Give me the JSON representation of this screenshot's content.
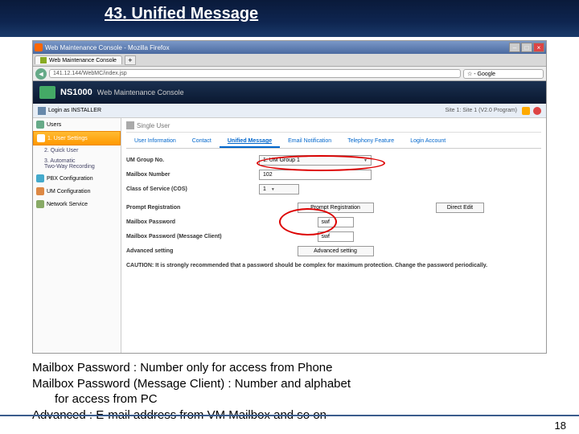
{
  "slide": {
    "title": "43. Unified Message",
    "page_number": "18"
  },
  "firefox": {
    "window_title": "Web Maintenance Console - Mozilla Firefox",
    "tab_title": "Web Maintenance Console",
    "address": "141.12.144/WebMC/index.jsp",
    "search_placeholder": "Google"
  },
  "wmc": {
    "product": "NS1000",
    "title": "Web Maintenance Console",
    "login_user": "Login as INSTALLER",
    "site_info": "Site 1: Site 1 (V2.0 Program)"
  },
  "sidebar": {
    "items": [
      {
        "label": "Users"
      },
      {
        "label": "1. User Settings",
        "selected": true
      },
      {
        "label": "2. Quick User",
        "sub": true
      },
      {
        "label": "3. Automatic\nTwo-Way Recording",
        "sub": true
      },
      {
        "label": "PBX Configuration"
      },
      {
        "label": "UM Configuration"
      },
      {
        "label": "Network Service"
      }
    ]
  },
  "breadcrumb": "Single User",
  "tabs": [
    {
      "label": "User Information"
    },
    {
      "label": "Contact"
    },
    {
      "label": "Unified Message",
      "active": true
    },
    {
      "label": "Email Notification"
    },
    {
      "label": "Telephony Feature"
    },
    {
      "label": "Login Account"
    }
  ],
  "form": {
    "um_group": {
      "label": "UM Group No.",
      "value": "1: UM Group 1"
    },
    "mailbox_no": {
      "label": "Mailbox Number",
      "value": "102"
    },
    "cos": {
      "label": "Class of Service (COS)",
      "value": "1"
    },
    "prompt": {
      "label": "Prompt Registration",
      "btn1": "Prompt Registration",
      "btn2": "Direct Edit"
    },
    "pwd1": {
      "label": "Mailbox Password",
      "value": "swf"
    },
    "pwd2": {
      "label": "Mailbox Password (Message Client)",
      "value": "swf"
    },
    "advanced": {
      "label": "Advanced setting",
      "btn": "Advanced setting"
    },
    "caution": "CAUTION: It is strongly recommended that a password should be complex for maximum protection. Change the password periodically."
  },
  "notes": {
    "l1": "Mailbox Password : Number only for access from Phone",
    "l2": "Mailbox Password (Message Client) : Number and alphabet",
    "l3": "for access from PC",
    "l4": "Advanced : E-mail address from VM Mailbox and so on"
  }
}
